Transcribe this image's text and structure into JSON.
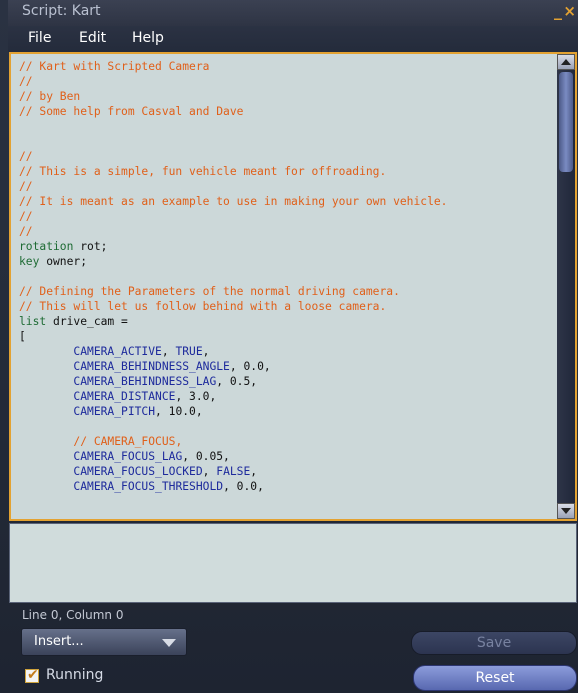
{
  "window": {
    "title": "Script: Kart",
    "minimize_glyph": "_",
    "close_glyph": "×"
  },
  "menu": {
    "file": "File",
    "edit": "Edit",
    "help": "Help"
  },
  "editor": {
    "lines": [
      [
        {
          "t": "// Kart with Scripted Camera",
          "c": "comment"
        }
      ],
      [
        {
          "t": "//",
          "c": "comment"
        }
      ],
      [
        {
          "t": "// by Ben",
          "c": "comment"
        }
      ],
      [
        {
          "t": "// Some help from Casval and Dave",
          "c": "comment"
        }
      ],
      [],
      [],
      [
        {
          "t": "//",
          "c": "comment"
        }
      ],
      [
        {
          "t": "// This is a simple, fun vehicle meant for offroading.",
          "c": "comment"
        }
      ],
      [
        {
          "t": "//",
          "c": "comment"
        }
      ],
      [
        {
          "t": "// It is meant as an example to use in making your own vehicle.",
          "c": "comment"
        }
      ],
      [
        {
          "t": "//",
          "c": "comment"
        }
      ],
      [
        {
          "t": "//",
          "c": "comment"
        }
      ],
      [
        {
          "t": "rotation",
          "c": "type"
        },
        {
          "t": " rot;",
          "c": "plain"
        }
      ],
      [
        {
          "t": "key",
          "c": "type"
        },
        {
          "t": " owner;",
          "c": "plain"
        }
      ],
      [],
      [
        {
          "t": "// Defining the Parameters of the normal driving camera.",
          "c": "comment"
        }
      ],
      [
        {
          "t": "// This will let us follow behind with a loose camera.",
          "c": "comment"
        }
      ],
      [
        {
          "t": "list",
          "c": "type"
        },
        {
          "t": " drive_cam =",
          "c": "plain"
        }
      ],
      [
        {
          "t": "[",
          "c": "plain"
        }
      ],
      [
        {
          "t": "        ",
          "c": "plain"
        },
        {
          "t": "CAMERA_ACTIVE",
          "c": "const"
        },
        {
          "t": ", ",
          "c": "plain"
        },
        {
          "t": "TRUE",
          "c": "const"
        },
        {
          "t": ",",
          "c": "plain"
        }
      ],
      [
        {
          "t": "        ",
          "c": "plain"
        },
        {
          "t": "CAMERA_BEHINDNESS_ANGLE",
          "c": "const"
        },
        {
          "t": ", 0.0,",
          "c": "plain"
        }
      ],
      [
        {
          "t": "        ",
          "c": "plain"
        },
        {
          "t": "CAMERA_BEHINDNESS_LAG",
          "c": "const"
        },
        {
          "t": ", 0.5,",
          "c": "plain"
        }
      ],
      [
        {
          "t": "        ",
          "c": "plain"
        },
        {
          "t": "CAMERA_DISTANCE",
          "c": "const"
        },
        {
          "t": ", 3.0,",
          "c": "plain"
        }
      ],
      [
        {
          "t": "        ",
          "c": "plain"
        },
        {
          "t": "CAMERA_PITCH",
          "c": "const"
        },
        {
          "t": ", 10.0,",
          "c": "plain"
        }
      ],
      [],
      [
        {
          "t": "        ",
          "c": "plain"
        },
        {
          "t": "// CAMERA_FOCUS,",
          "c": "comment"
        }
      ],
      [
        {
          "t": "        ",
          "c": "plain"
        },
        {
          "t": "CAMERA_FOCUS_LAG",
          "c": "const"
        },
        {
          "t": ", 0.05,",
          "c": "plain"
        }
      ],
      [
        {
          "t": "        ",
          "c": "plain"
        },
        {
          "t": "CAMERA_FOCUS_LOCKED",
          "c": "const"
        },
        {
          "t": ", ",
          "c": "plain"
        },
        {
          "t": "FALSE",
          "c": "const"
        },
        {
          "t": ",",
          "c": "plain"
        }
      ],
      [
        {
          "t": "        ",
          "c": "plain"
        },
        {
          "t": "CAMERA_FOCUS_THRESHOLD",
          "c": "const"
        },
        {
          "t": ", 0.0,",
          "c": "plain"
        }
      ]
    ]
  },
  "status": {
    "position": "Line 0, Column 0"
  },
  "controls": {
    "insert_label": "Insert...",
    "save_label": "Save",
    "reset_label": "Reset",
    "running_label": "Running",
    "running_checked": true
  },
  "colors": {
    "accent": "#e3a232",
    "comment": "#e0601a",
    "type": "#1e6b34",
    "constant": "#1d2a9c",
    "editor_background": "#ccd8d9"
  },
  "icons": {
    "scroll_up": "arrow-up-icon",
    "scroll_down": "arrow-down-icon",
    "dropdown": "chevron-down-icon",
    "checkbox": "checkmark-icon"
  }
}
